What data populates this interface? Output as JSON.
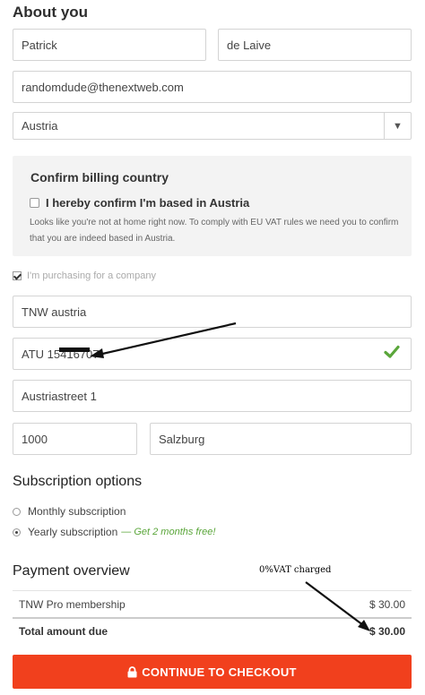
{
  "about": {
    "title": "About you",
    "first_name": "Patrick",
    "last_name": "de Laive",
    "email": "randomdude@thenextweb.com",
    "country": "Austria"
  },
  "confirm": {
    "title": "Confirm billing country",
    "checkbox_label": "I hereby confirm I'm based in Austria",
    "note": "Looks like you're not at home right now. To comply with EU VAT rules we need you to confirm that you are indeed based in Austria."
  },
  "company": {
    "checkbox_label": "I'm purchasing for a company",
    "company_name": "TNW austria",
    "vat_number": "ATU 15416707",
    "street": "Austriastreet 1",
    "zip": "1000",
    "city": "Salzburg"
  },
  "subscription": {
    "title": "Subscription options",
    "monthly": "Monthly subscription",
    "yearly": "Yearly subscription",
    "yearly_promo": "— Get 2 months free!"
  },
  "payment": {
    "title": "Payment overview",
    "annotation": "0%VAT charged",
    "item_label": "TNW Pro membership",
    "item_price": "$ 30.00",
    "total_label": "Total amount due",
    "total_price": "$ 30.00"
  },
  "checkout_label": "CONTINUE TO CHECKOUT",
  "colors": {
    "accent": "#f1401d",
    "valid": "#5aa63a",
    "panel": "#f3f3f3"
  }
}
